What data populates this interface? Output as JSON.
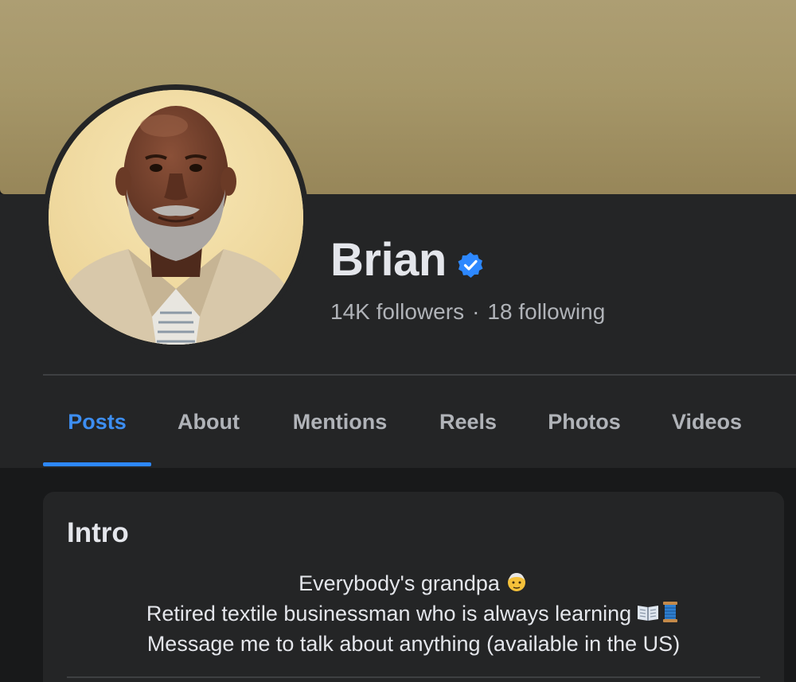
{
  "profile": {
    "name": "Brian",
    "verified": true,
    "followers": "14K followers",
    "separator": "·",
    "following": "18 following"
  },
  "tabs": [
    {
      "label": "Posts",
      "active": true
    },
    {
      "label": "About",
      "active": false
    },
    {
      "label": "Mentions",
      "active": false
    },
    {
      "label": "Reels",
      "active": false
    },
    {
      "label": "Photos",
      "active": false
    },
    {
      "label": "Videos",
      "active": false
    }
  ],
  "intro": {
    "title": "Intro",
    "bio": [
      {
        "text": "Everybody's grandpa",
        "icons": [
          "older-man-emoji-icon"
        ]
      },
      {
        "text": "Retired textile businessman who is always learning",
        "icons": [
          "open-book-emoji-icon",
          "thread-spool-emoji-icon"
        ]
      },
      {
        "text": "Message me to talk about anything (available in the US)",
        "icons": []
      }
    ]
  },
  "colors": {
    "accent": "#2d88ff",
    "active_tab_text": "#3d8ef2",
    "panel": "#242526",
    "background": "#18191a",
    "cover": "#a69769",
    "primary_text": "#e4e6eb",
    "secondary_text": "#b0b3b8"
  }
}
